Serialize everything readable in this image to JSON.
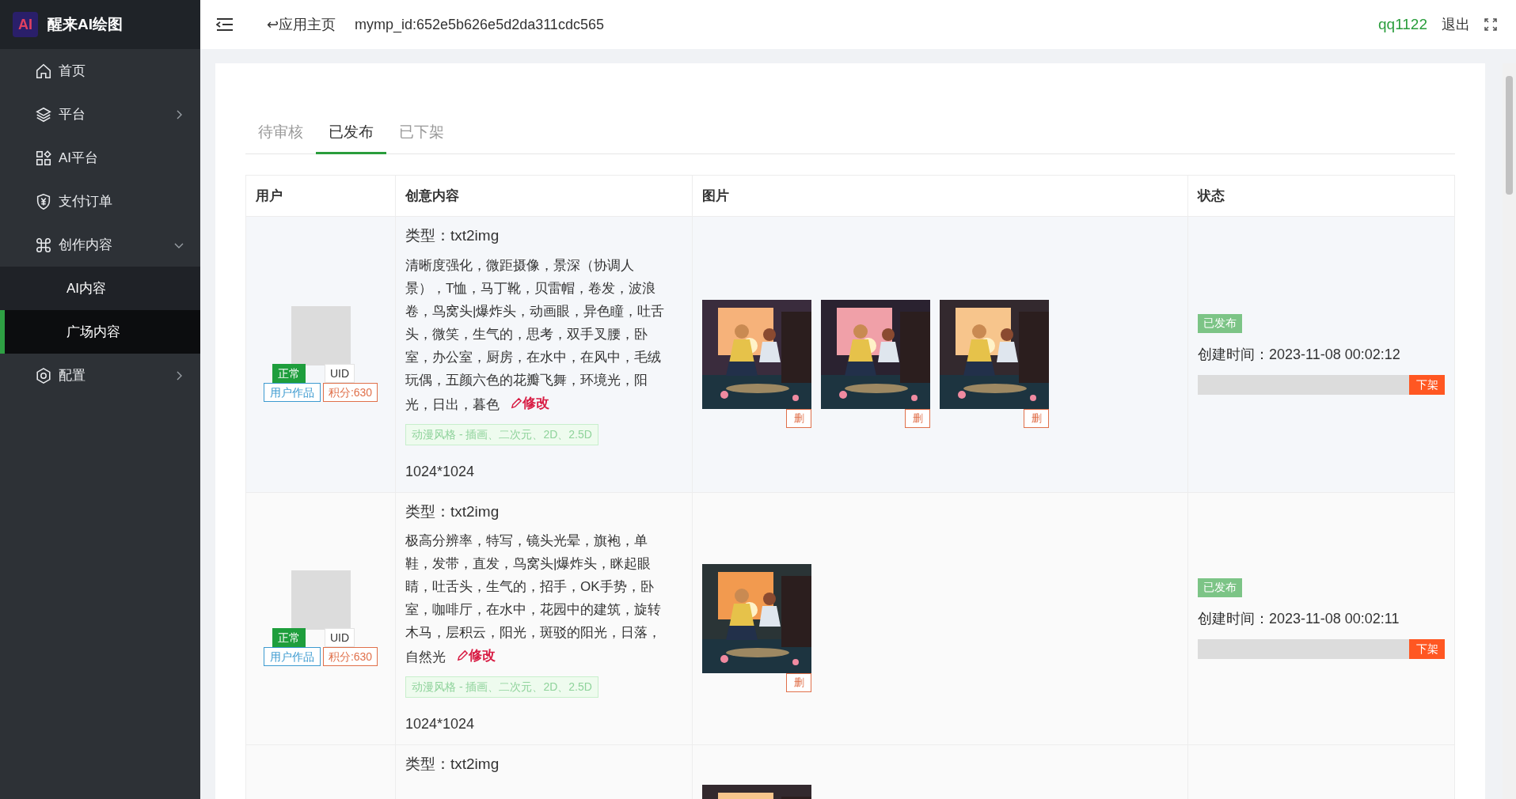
{
  "sidebar": {
    "logo": "AI",
    "title": "醒来AI绘图",
    "items": [
      {
        "label": "首页",
        "selected": false
      },
      {
        "label": "平台",
        "selected": false,
        "expanded": false
      },
      {
        "label": "AI平台",
        "selected": false
      },
      {
        "label": "支付订单",
        "selected": false
      },
      {
        "label": "创作内容",
        "selected": false,
        "expanded": true,
        "children": [
          {
            "label": "AI内容",
            "selected": false
          },
          {
            "label": "广场内容",
            "selected": true
          }
        ]
      },
      {
        "label": "配置",
        "selected": false,
        "expanded": false
      }
    ]
  },
  "header": {
    "home_link": "↩应用主页",
    "app_id": "mymp_id:652e5b626e5d2da311cdc565",
    "user": "qq1122",
    "logout": "退出"
  },
  "tabs": [
    {
      "label": "待审核",
      "selected": false
    },
    {
      "label": "已发布",
      "selected": true
    },
    {
      "label": "已下架",
      "selected": false
    }
  ],
  "table": {
    "columns": [
      "用户",
      "创意内容",
      "图片",
      "状态"
    ],
    "rows": [
      {
        "user": {
          "status": "正常",
          "uid": "UID",
          "source": "用户作品",
          "points": "积分:630"
        },
        "content": {
          "type": "类型：txt2img",
          "prompt": "清晰度强化，微距摄像，景深（协调人景），T恤，马丁靴，贝雷帽，卷发，波浪卷，鸟窝头|爆炸头，动画眼，异色瞳，吐舌头，微笑，生气的，思考，双手叉腰，卧室，办公室，厨房，在水中，在风中，毛绒玩偶，五颜六色的花瓣飞舞，环境光，阳光，日出，暮色",
          "edit": "修改",
          "style": "动漫风格 - 插画、二次元、2D、2.5D",
          "size": "1024*1024"
        },
        "images": [
          {
            "kind": "picture",
            "delete": "删"
          },
          {
            "kind": "picture",
            "delete": "删"
          },
          {
            "kind": "picture",
            "delete": "删"
          }
        ],
        "status": {
          "badge": "已发布",
          "created": "创建时间：2023-11-08 00:02:12",
          "action": "下架"
        }
      },
      {
        "user": {
          "status": "正常",
          "uid": "UID",
          "source": "用户作品",
          "points": "积分:630"
        },
        "content": {
          "type": "类型：txt2img",
          "prompt": "极高分辨率，特写，镜头光晕，旗袍，单鞋，发带，直发，鸟窝头|爆炸头，眯起眼睛，吐舌头，生气的，招手，OK手势，卧室，咖啡厅，在水中，花园中的建筑，旋转木马，层积云，阳光，斑驳的阳光，日落，自然光",
          "edit": "修改",
          "style": "动漫风格 - 插画、二次元、2D、2.5D",
          "size": "1024*1024"
        },
        "images": [
          {
            "kind": "picture",
            "delete": "删"
          }
        ],
        "status": {
          "badge": "已发布",
          "created": "创建时间：2023-11-08 00:02:11",
          "action": "下架"
        }
      },
      {
        "content": {
          "type": "类型：txt2img"
        }
      }
    ]
  }
}
